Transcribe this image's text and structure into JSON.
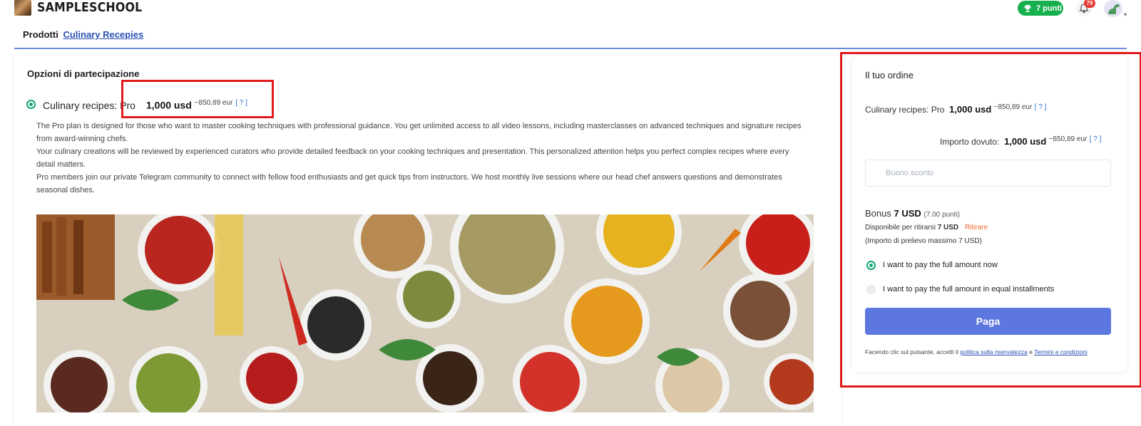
{
  "header": {
    "brand": "SAMPLESCHOOL",
    "points_label": "7 punti",
    "notifications_count": "79"
  },
  "breadcrumb": {
    "section": "Prodotti",
    "current": "Culinary Recepies"
  },
  "options": {
    "title": "Opzioni di partecipazione",
    "plan": {
      "name": "Culinary recipes: Pro",
      "price": "1,000 usd",
      "conversion": "~850,89 eur",
      "help": "[ ? ]",
      "selected": true
    },
    "description": [
      "The Pro plan is designed for those who want to master cooking techniques with professional guidance. You get unlimited access to all video lessons, including masterclasses on advanced techniques and signature recipes from award-winning chefs.",
      "Your culinary creations will be reviewed by experienced curators who provide detailed feedback on your cooking techniques and presentation. This personalized attention helps you perfect complex recipes where every detail matters.",
      "Pro members join our private Telegram community to connect with fellow food enthusiasts and get quick tips from instructors. We host monthly live sessions where our head chef answers questions and demonstrates seasonal dishes."
    ]
  },
  "order": {
    "title": "Il tuo ordine",
    "item_name": "Culinary recipes: Pro",
    "item_price": "1,000 usd",
    "item_conversion": "~850,89 eur",
    "item_help": "[ ? ]",
    "due_label": "Importo dovuto:",
    "due_price": "1,000 usd",
    "due_conversion": "~850,89 eur",
    "due_help": "[ ? ]",
    "coupon_placeholder": "Buono sconto",
    "bonus_label": "Bonus",
    "bonus_value": "7 USD",
    "bonus_points": "(7.00 punti)",
    "available_label": "Disponibile per ritirarsi",
    "available_value": "7 USD",
    "withdraw_label": "Ritirare",
    "max_withdraw": "(Importo di prelievo massimo 7 USD)",
    "pay_options": [
      {
        "label": "I want to pay the full amount now",
        "selected": true
      },
      {
        "label": "I want to pay the full amount in equal installments",
        "selected": false
      }
    ],
    "pay_button": "Paga",
    "terms_prefix": "Facendo clic sul pulsante, accetti il",
    "privacy_link": "politica sulla riservatezza",
    "terms_and": "e",
    "terms_link": "Termini e condizioni"
  },
  "colors": {
    "accent": "#5c78e0",
    "success": "#16b04e",
    "highlight": "#e11b1b",
    "link": "#2a4fb5"
  }
}
